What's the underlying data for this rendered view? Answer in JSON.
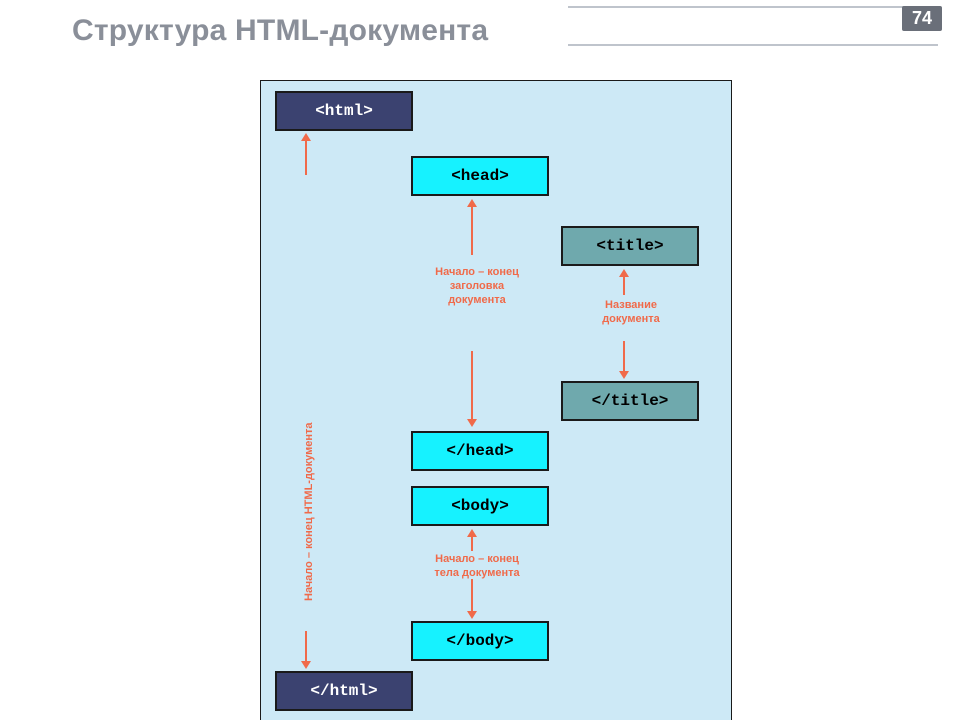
{
  "page_number": "74",
  "title": "Структура HTML-документа",
  "tags": {
    "html_open": "<html>",
    "head_open": "<head>",
    "title_open": "<title>",
    "title_close": "</title>",
    "head_close": "</head>",
    "body_open": "<body>",
    "body_close": "</body>",
    "html_close": "</html>"
  },
  "notes": {
    "doc": "Начало – конец HTML-документа",
    "header_l1": "Начало – конец",
    "header_l2": "заголовка",
    "header_l3": "документа",
    "title_l1": "Название",
    "title_l2": "документа",
    "body_l1": "Начало – конец",
    "body_l2": "тела документа"
  }
}
